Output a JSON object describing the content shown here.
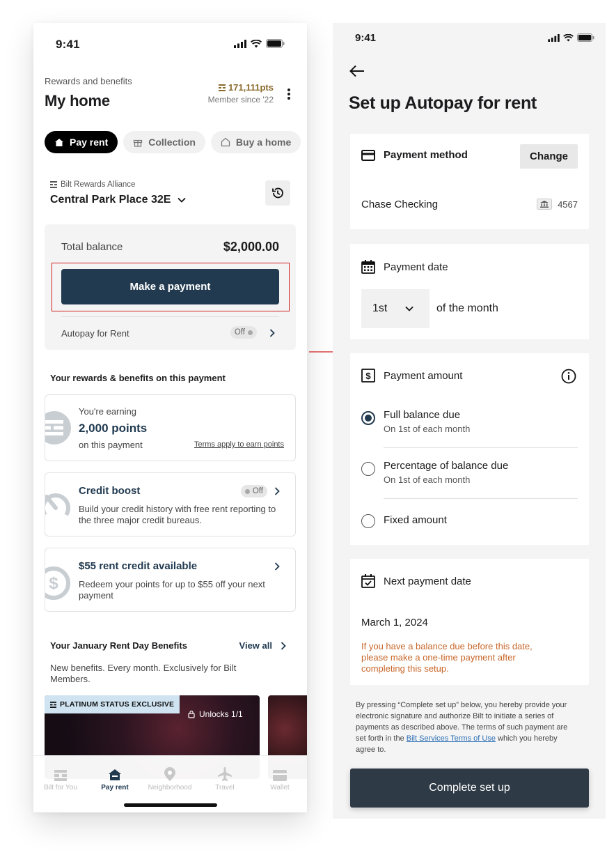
{
  "left_screen": {
    "status_time": "9:41",
    "header": {
      "subtitle": "Rewards and benefits",
      "title": "My home",
      "points": "171,111pts",
      "member_since": "Member since '22"
    },
    "pills": [
      {
        "label": "Pay rent",
        "active": true
      },
      {
        "label": "Collection",
        "active": false
      },
      {
        "label": "Buy a home",
        "active": false
      }
    ],
    "property": {
      "brand": "Bilt Rewards Alliance",
      "name": "Central Park Place 32E"
    },
    "balance": {
      "label": "Total balance",
      "amount": "$2,000.00",
      "pay_button": "Make a payment",
      "autopay_label": "Autopay for Rent",
      "autopay_status": "Off"
    },
    "rewards": {
      "heading": "Your rewards & benefits on this payment",
      "earning_label": "You're earning",
      "earning_points": "2,000 points",
      "earning_sub": "on this payment",
      "terms_link": "Terms apply to earn points",
      "credit_boost_title": "Credit boost",
      "credit_boost_status": "Off",
      "credit_boost_desc": "Build your credit history with free rent reporting to the three major credit bureaus.",
      "rent_credit_title": "$55 rent credit available",
      "rent_credit_desc": "Redeem your points for up to $55 off your next payment"
    },
    "benefits": {
      "heading": "Your January Rent Day Benefits",
      "view_all": "View all",
      "desc": "New benefits. Every month. Exclusively for Bilt Members.",
      "promo_tag": "PLATINUM STATUS EXCLUSIVE",
      "promo_unlocks": "Unlocks 1/1"
    },
    "tabbar": [
      {
        "label": "Bilt for You",
        "icon": "grid-icon",
        "active": false
      },
      {
        "label": "Pay rent",
        "icon": "home-icon",
        "active": true
      },
      {
        "label": "Neighborhood",
        "icon": "map-pin-icon",
        "active": false
      },
      {
        "label": "Travel",
        "icon": "plane-icon",
        "active": false
      },
      {
        "label": "Wallet",
        "icon": "wallet-icon",
        "active": false
      }
    ]
  },
  "right_screen": {
    "status_time": "9:41",
    "title": "Set up Autopay for rent",
    "payment_method": {
      "heading": "Payment method",
      "change_button": "Change",
      "account_name": "Chase Checking",
      "account_last4": "4567"
    },
    "payment_date": {
      "heading": "Payment date",
      "selected_day": "1st",
      "suffix": "of the month"
    },
    "payment_amount": {
      "heading": "Payment amount",
      "options": [
        {
          "label": "Full balance due",
          "sub": "On 1st of each month",
          "checked": true
        },
        {
          "label": "Percentage of balance due",
          "sub": "On 1st of each month",
          "checked": false
        },
        {
          "label": "Fixed amount",
          "sub": "",
          "checked": false
        }
      ]
    },
    "next_payment": {
      "heading": "Next payment date",
      "date": "March 1, 2024",
      "warning": "If you have a balance due before this date, please make a one-time payment after completing this setup."
    },
    "legal_before": "By pressing “Complete set up” below, you hereby provide your electronic signature and authorize Bilt to initiate a series of payments as described above. The terms of such payment are set forth in the ",
    "legal_link": "Bilt Services Terms of Use",
    "legal_after": " which you hereby agree to.",
    "complete_button": "Complete set up"
  },
  "colors": {
    "navy": "#213a50",
    "highlight_red": "#d02020",
    "warning_orange": "#c8672a",
    "link_blue": "#2c6fb5",
    "points_gold": "#8b6a2c"
  }
}
